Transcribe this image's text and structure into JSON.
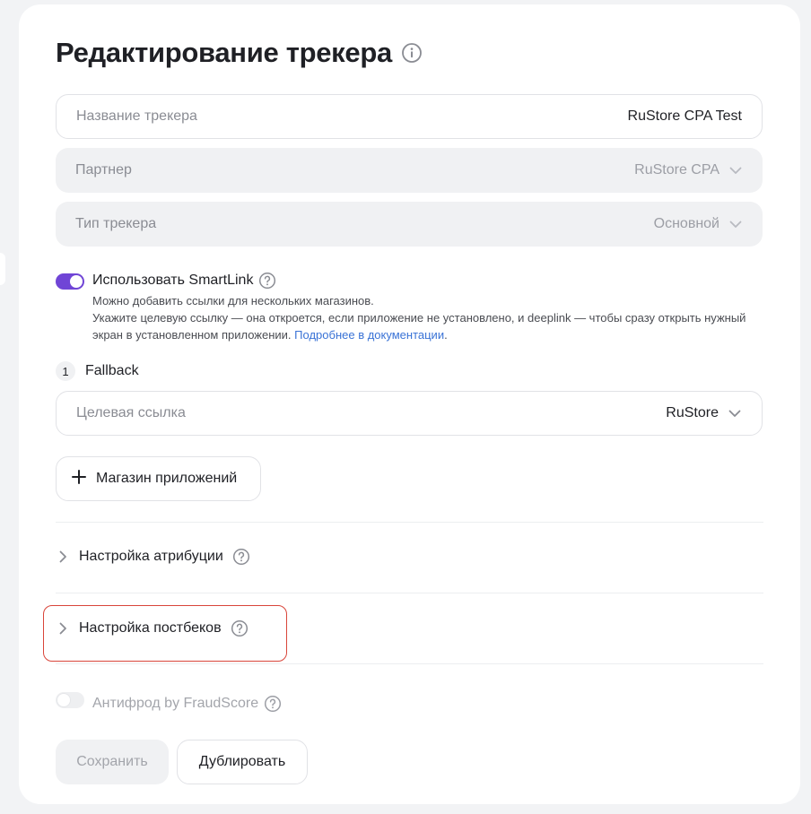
{
  "page": {
    "title": "Редактирование трекера"
  },
  "form": {
    "tracker_name": {
      "placeholder": "Название трекера",
      "value": "RuStore CPA Test"
    },
    "partner": {
      "placeholder": "Партнер",
      "value": "RuStore CPA"
    },
    "tracker_type": {
      "placeholder": "Тип трекера",
      "value": "Основной"
    }
  },
  "smartlink": {
    "label": "Использовать SmartLink",
    "enabled": true,
    "desc_line1": "Можно добавить ссылки для нескольких магазинов.",
    "desc_line2": "Укажите целевую ссылку — она откроется, если приложение не установлено, и deeplink — чтобы сразу открыть нужный экран в установленном приложении.",
    "docs_link": "Подробнее в документации",
    "desc_end": "."
  },
  "fallback": {
    "number": "1",
    "label": "Fallback",
    "target_link_placeholder": "Целевая ссылка",
    "target_link_value": "RuStore"
  },
  "add_store_button": "Магазин приложений",
  "sections": {
    "attribution": "Настройка атрибуции",
    "postbacks": "Настройка постбеков"
  },
  "antifraud": {
    "label": "Антифрод by FraudScore",
    "enabled": false
  },
  "actions": {
    "save": "Сохранить",
    "duplicate": "Дублировать"
  },
  "colors": {
    "accent": "#7045d6",
    "link": "#3a73d6",
    "highlight": "#d9453a"
  }
}
